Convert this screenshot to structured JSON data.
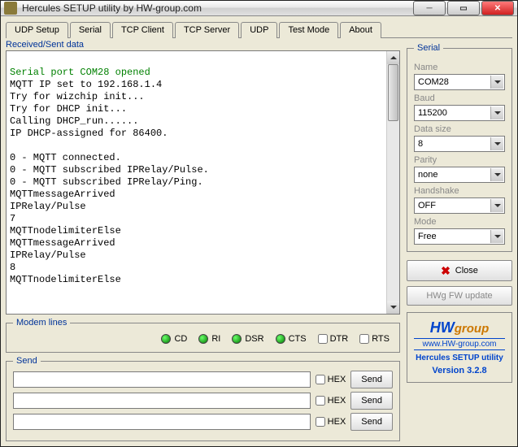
{
  "window": {
    "title": "Hercules SETUP utility by HW-group.com"
  },
  "tabs": [
    "UDP Setup",
    "Serial",
    "TCP Client",
    "TCP Server",
    "UDP",
    "Test Mode",
    "About"
  ],
  "active_tab": "Serial",
  "received_label": "Received/Sent data",
  "terminal": {
    "first_line": "Serial port COM28 opened",
    "body": "\nMQTT IP set to 192.168.1.4\nTry for wizchip init...\nTry for DHCP init...\nCalling DHCP_run......\nIP DHCP-assigned for 86400.\n\n0 - MQTT connected.\n0 - MQTT subscribed IPRelay/Pulse.\n0 - MQTT subscribed IPRelay/Ping.\nMQTTmessageArrived\nIPRelay/Pulse\n7\nMQTTnodelimiterElse\nMQTTmessageArrived\nIPRelay/Pulse\n8\nMQTTnodelimiterElse"
  },
  "modem": {
    "legend": "Modem lines",
    "leds": [
      "CD",
      "RI",
      "DSR",
      "CTS"
    ],
    "checks": [
      "DTR",
      "RTS"
    ]
  },
  "send": {
    "legend": "Send",
    "hex_label": "HEX",
    "send_label": "Send",
    "rows": [
      "",
      "",
      ""
    ]
  },
  "serial": {
    "legend": "Serial",
    "name_label": "Name",
    "name_value": "COM28",
    "baud_label": "Baud",
    "baud_value": "115200",
    "datasize_label": "Data size",
    "datasize_value": "8",
    "parity_label": "Parity",
    "parity_value": "none",
    "handshake_label": "Handshake",
    "handshake_value": "OFF",
    "mode_label": "Mode",
    "mode_value": "Free"
  },
  "buttons": {
    "close": "Close",
    "update": "HWg FW update"
  },
  "brand": {
    "logo_hw": "HW",
    "logo_group": "group",
    "site": "www.HW-group.com",
    "app": "Hercules SETUP utility",
    "version": "Version  3.2.8"
  }
}
